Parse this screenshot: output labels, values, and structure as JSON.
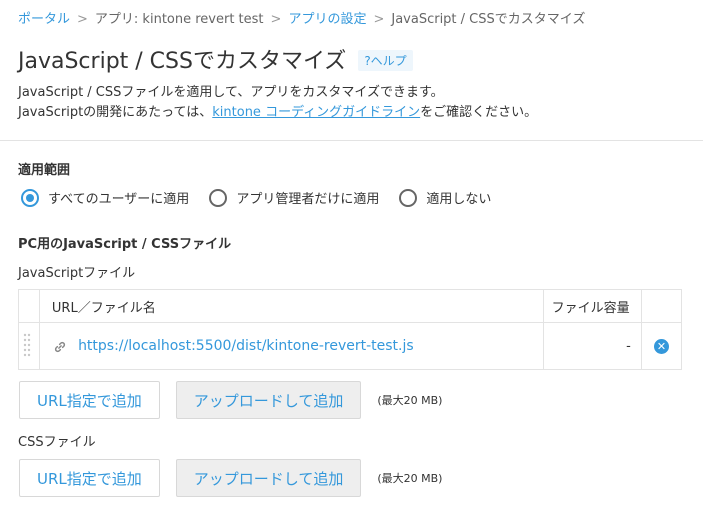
{
  "breadcrumb": {
    "portal": "ポータル",
    "app": "アプリ: kintone revert test",
    "settings": "アプリの設定",
    "current": "JavaScript / CSSでカスタマイズ",
    "separator": ">"
  },
  "page": {
    "title": "JavaScript / CSSでカスタマイズ",
    "help_label": "?ヘルプ",
    "desc_line1": "JavaScript / CSSファイルを適用して、アプリをカスタマイズできます。",
    "desc_line2_prefix": "JavaScriptの開発にあたっては、",
    "desc_line2_link": "kintone コーディングガイドライン",
    "desc_line2_suffix": "をご確認ください。"
  },
  "scope": {
    "label": "適用範囲",
    "options": [
      {
        "label": "すべてのユーザーに適用",
        "checked": true
      },
      {
        "label": "アプリ管理者だけに適用",
        "checked": false
      },
      {
        "label": "適用しない",
        "checked": false
      }
    ]
  },
  "pc": {
    "section_title": "PC用のJavaScript / CSSファイル",
    "js_label": "JavaScriptファイル",
    "table": {
      "col_name": "URL／ファイル名",
      "col_size": "ファイル容量",
      "rows": [
        {
          "url": "https://localhost:5500/dist/kintone-revert-test.js",
          "size": "-"
        }
      ]
    },
    "js_buttons": {
      "url_add": "URL指定で追加",
      "upload_add": "アップロードして追加",
      "max_size": "(最大20 MB)"
    },
    "css_label": "CSSファイル",
    "css_buttons": {
      "url_add": "URL指定で追加",
      "upload_add": "アップロードして追加",
      "max_size": "(最大20 MB)"
    }
  },
  "colors": {
    "accent": "#3498db",
    "text": "#333333",
    "border": "#e3e3e3"
  }
}
